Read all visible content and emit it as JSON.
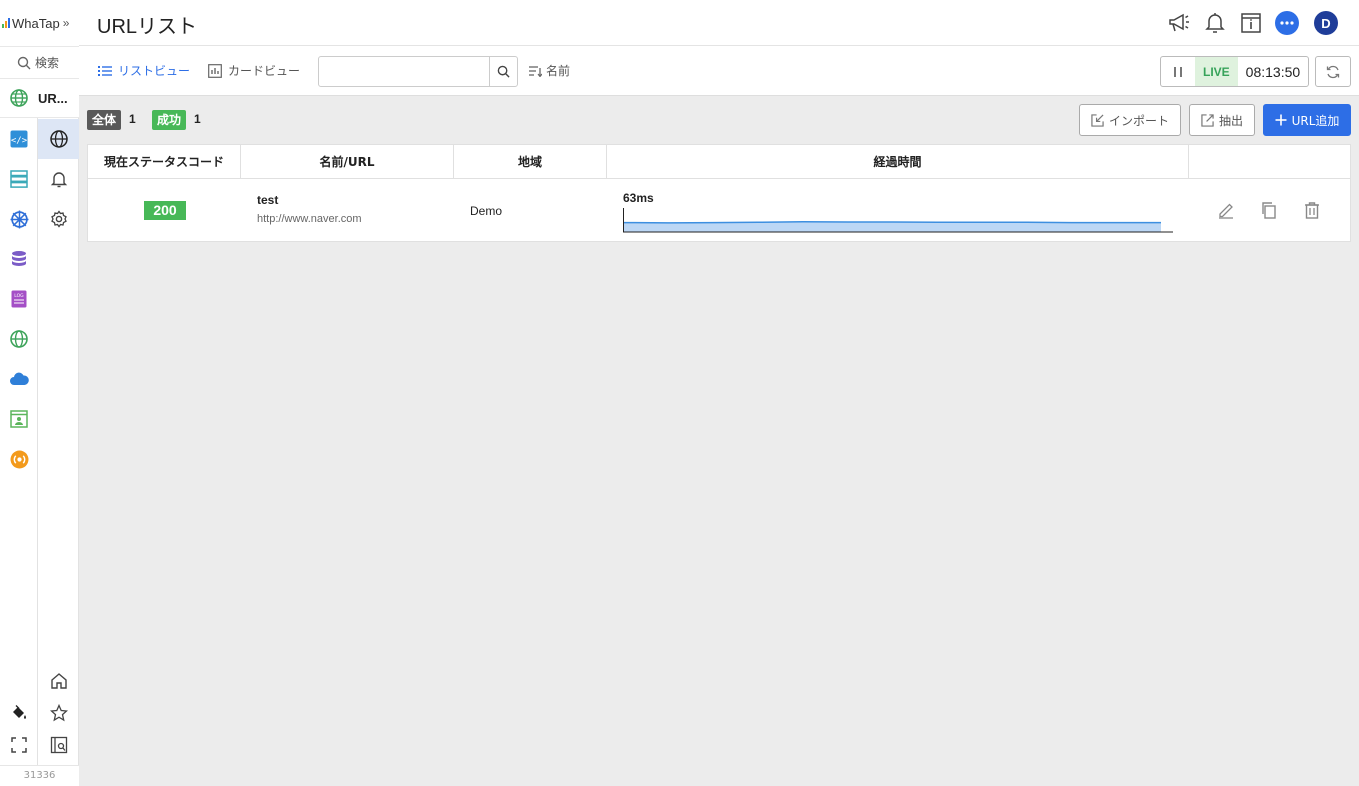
{
  "brand": {
    "name": "WhaTap"
  },
  "sidebar": {
    "search_label": "検索",
    "project_label": "UR...",
    "products": [
      {
        "icon": "code-icon",
        "color": "#2f8fd8"
      },
      {
        "icon": "server-icon",
        "color": "#3aa9b8"
      },
      {
        "icon": "kubernetes-icon",
        "color": "#2f6fd8"
      },
      {
        "icon": "database-icon",
        "color": "#7b5cc7"
      },
      {
        "icon": "log-icon",
        "color": "#a44fc6"
      },
      {
        "icon": "globe-icon",
        "color": "#3da35a"
      },
      {
        "icon": "cloud-icon",
        "color": "#2f7fd8"
      },
      {
        "icon": "browser-user-icon",
        "color": "#5bb55b"
      },
      {
        "icon": "signal-icon",
        "color": "#f39a1c"
      }
    ],
    "version": "31336"
  },
  "header": {
    "title": "URLリスト",
    "avatar_letter": "D"
  },
  "toolbar": {
    "list_view_label": "リストビュー",
    "card_view_label": "カードビュー",
    "search_value": "",
    "sort_label": "名前",
    "live_label": "LIVE",
    "clock": "08:13:50"
  },
  "summary": {
    "total_label": "全体",
    "total_count": "1",
    "success_label": "成功",
    "success_count": "1"
  },
  "actions": {
    "import_label": "インポート",
    "export_label": "抽出",
    "add_label": "URL追加"
  },
  "table": {
    "headers": [
      "現在ステータスコード",
      "名前/URL",
      "地域",
      "経過時間"
    ],
    "rows": [
      {
        "status_code": "200",
        "name": "test",
        "url": "http://www.naver.com",
        "region": "Demo",
        "elapsed": "63ms",
        "trend": [
          63,
          62,
          63,
          64,
          66,
          65,
          65,
          64,
          64,
          64,
          63,
          63,
          63
        ]
      }
    ]
  },
  "colors": {
    "accent": "#2d6ee6",
    "success": "#47b857",
    "total_badge": "#595959",
    "live": "#37a35a"
  }
}
